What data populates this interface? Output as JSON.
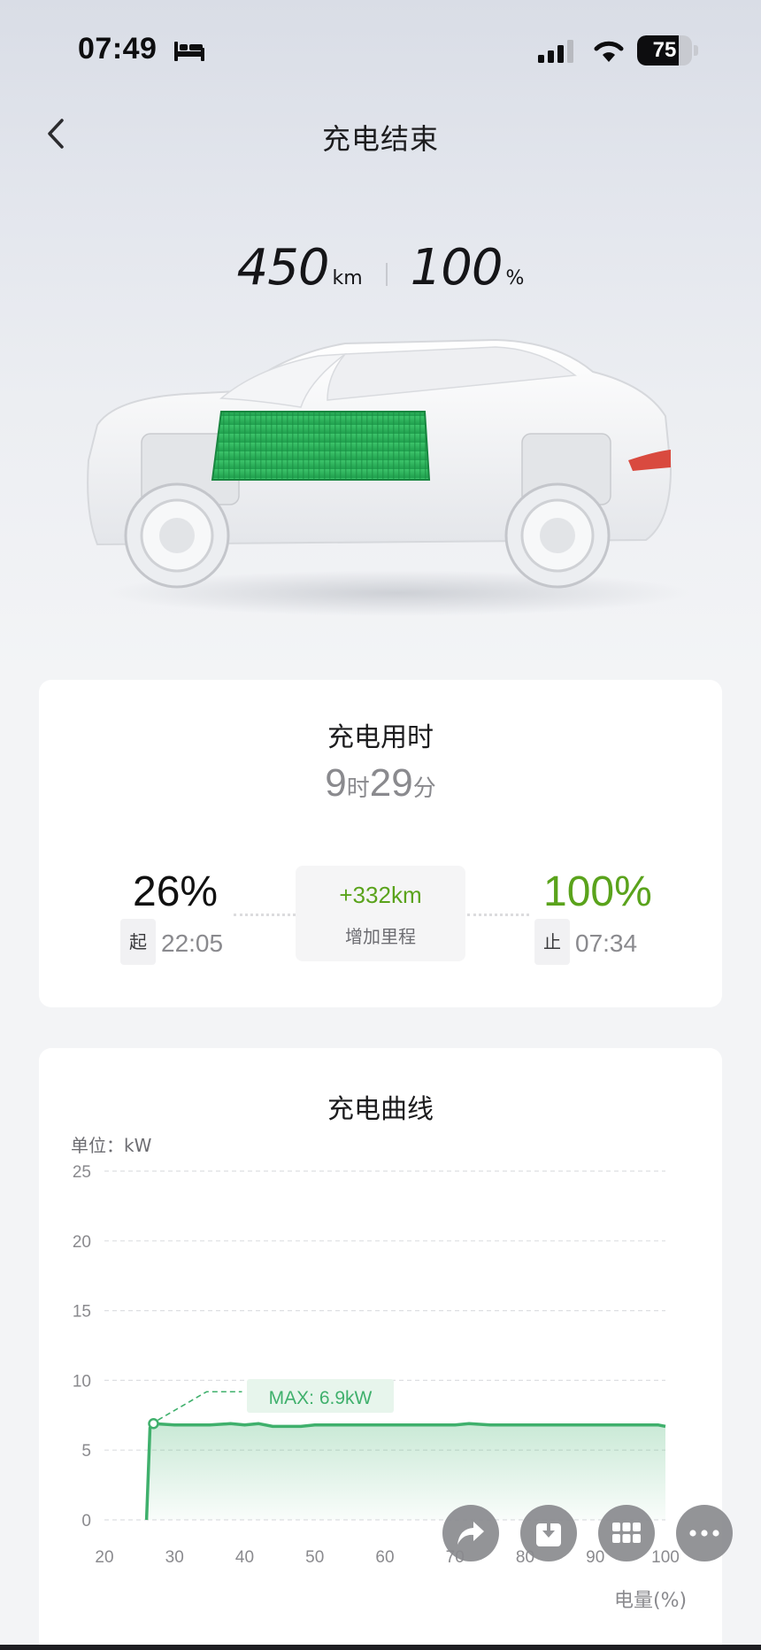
{
  "status_bar": {
    "time": "07:49",
    "battery": "75",
    "battery_level": 0.75,
    "icons": [
      "bed-icon",
      "cellular-signal-icon",
      "wifi-icon",
      "battery-icon"
    ]
  },
  "nav": {
    "back_icon": "chevron-left-icon",
    "title": "充电结束"
  },
  "summary": {
    "range_value": "450",
    "range_unit": "km",
    "soc_value": "100",
    "soc_unit": "%"
  },
  "duration_card": {
    "title": "充电用时",
    "hours": "9",
    "hours_unit": "时",
    "minutes": "29",
    "minutes_unit": "分",
    "start_soc": "26%",
    "start_tag": "起",
    "start_time": "22:05",
    "end_soc": "100%",
    "end_tag": "止",
    "end_time": "07:34",
    "added_range": "+332km",
    "added_label": "增加里程"
  },
  "colors": {
    "accent_green": "#5aa31c",
    "curve_green": "#3fb06c",
    "battery_green": "#2fb85f"
  },
  "curve_card": {
    "title": "充电曲线",
    "unit_label": "单位：kW",
    "xaxis_title": "电量(%)",
    "max_label": "MAX: 6.9kW"
  },
  "chart_data": {
    "type": "area",
    "title": "充电曲线",
    "ylabel": "单位：kW",
    "xlabel": "电量(%)",
    "xlim": [
      20,
      100
    ],
    "ylim": [
      0,
      25
    ],
    "xticks": [
      20,
      30,
      40,
      50,
      60,
      70,
      80,
      90,
      100
    ],
    "yticks": [
      0,
      5,
      10,
      15,
      20,
      25
    ],
    "grid": true,
    "annotation": "MAX: 6.9kW",
    "series": [
      {
        "x": [
          26,
          26.5,
          27,
          30,
          35,
          38,
          40,
          42,
          44,
          48,
          50,
          55,
          60,
          65,
          70,
          72,
          75,
          80,
          85,
          90,
          95,
          99,
          100
        ],
        "y": [
          0,
          6.6,
          6.9,
          6.8,
          6.8,
          6.9,
          6.8,
          6.9,
          6.7,
          6.7,
          6.8,
          6.8,
          6.8,
          6.8,
          6.8,
          6.9,
          6.8,
          6.8,
          6.8,
          6.8,
          6.8,
          6.8,
          6.7
        ]
      }
    ]
  },
  "actions": {
    "items": [
      "share-icon",
      "download-icon",
      "grid-icon",
      "more-icon"
    ]
  }
}
